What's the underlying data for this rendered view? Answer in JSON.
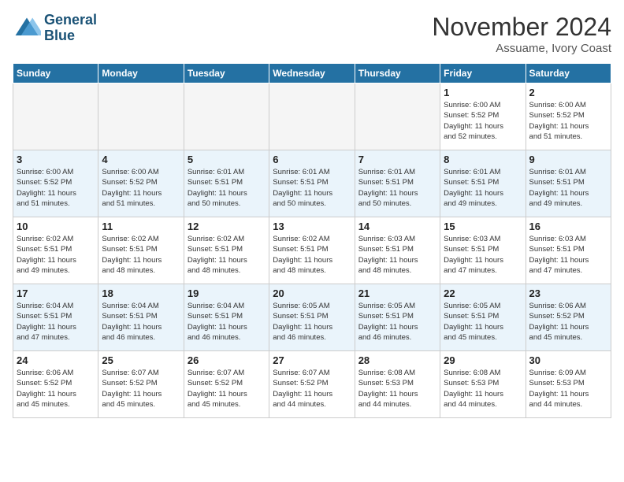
{
  "header": {
    "logo_line1": "General",
    "logo_line2": "Blue",
    "month": "November 2024",
    "location": "Assuame, Ivory Coast"
  },
  "weekdays": [
    "Sunday",
    "Monday",
    "Tuesday",
    "Wednesday",
    "Thursday",
    "Friday",
    "Saturday"
  ],
  "weeks": [
    [
      {
        "day": "",
        "info": ""
      },
      {
        "day": "",
        "info": ""
      },
      {
        "day": "",
        "info": ""
      },
      {
        "day": "",
        "info": ""
      },
      {
        "day": "",
        "info": ""
      },
      {
        "day": "1",
        "info": "Sunrise: 6:00 AM\nSunset: 5:52 PM\nDaylight: 11 hours\nand 52 minutes."
      },
      {
        "day": "2",
        "info": "Sunrise: 6:00 AM\nSunset: 5:52 PM\nDaylight: 11 hours\nand 51 minutes."
      }
    ],
    [
      {
        "day": "3",
        "info": "Sunrise: 6:00 AM\nSunset: 5:52 PM\nDaylight: 11 hours\nand 51 minutes."
      },
      {
        "day": "4",
        "info": "Sunrise: 6:00 AM\nSunset: 5:52 PM\nDaylight: 11 hours\nand 51 minutes."
      },
      {
        "day": "5",
        "info": "Sunrise: 6:01 AM\nSunset: 5:51 PM\nDaylight: 11 hours\nand 50 minutes."
      },
      {
        "day": "6",
        "info": "Sunrise: 6:01 AM\nSunset: 5:51 PM\nDaylight: 11 hours\nand 50 minutes."
      },
      {
        "day": "7",
        "info": "Sunrise: 6:01 AM\nSunset: 5:51 PM\nDaylight: 11 hours\nand 50 minutes."
      },
      {
        "day": "8",
        "info": "Sunrise: 6:01 AM\nSunset: 5:51 PM\nDaylight: 11 hours\nand 49 minutes."
      },
      {
        "day": "9",
        "info": "Sunrise: 6:01 AM\nSunset: 5:51 PM\nDaylight: 11 hours\nand 49 minutes."
      }
    ],
    [
      {
        "day": "10",
        "info": "Sunrise: 6:02 AM\nSunset: 5:51 PM\nDaylight: 11 hours\nand 49 minutes."
      },
      {
        "day": "11",
        "info": "Sunrise: 6:02 AM\nSunset: 5:51 PM\nDaylight: 11 hours\nand 48 minutes."
      },
      {
        "day": "12",
        "info": "Sunrise: 6:02 AM\nSunset: 5:51 PM\nDaylight: 11 hours\nand 48 minutes."
      },
      {
        "day": "13",
        "info": "Sunrise: 6:02 AM\nSunset: 5:51 PM\nDaylight: 11 hours\nand 48 minutes."
      },
      {
        "day": "14",
        "info": "Sunrise: 6:03 AM\nSunset: 5:51 PM\nDaylight: 11 hours\nand 48 minutes."
      },
      {
        "day": "15",
        "info": "Sunrise: 6:03 AM\nSunset: 5:51 PM\nDaylight: 11 hours\nand 47 minutes."
      },
      {
        "day": "16",
        "info": "Sunrise: 6:03 AM\nSunset: 5:51 PM\nDaylight: 11 hours\nand 47 minutes."
      }
    ],
    [
      {
        "day": "17",
        "info": "Sunrise: 6:04 AM\nSunset: 5:51 PM\nDaylight: 11 hours\nand 47 minutes."
      },
      {
        "day": "18",
        "info": "Sunrise: 6:04 AM\nSunset: 5:51 PM\nDaylight: 11 hours\nand 46 minutes."
      },
      {
        "day": "19",
        "info": "Sunrise: 6:04 AM\nSunset: 5:51 PM\nDaylight: 11 hours\nand 46 minutes."
      },
      {
        "day": "20",
        "info": "Sunrise: 6:05 AM\nSunset: 5:51 PM\nDaylight: 11 hours\nand 46 minutes."
      },
      {
        "day": "21",
        "info": "Sunrise: 6:05 AM\nSunset: 5:51 PM\nDaylight: 11 hours\nand 46 minutes."
      },
      {
        "day": "22",
        "info": "Sunrise: 6:05 AM\nSunset: 5:51 PM\nDaylight: 11 hours\nand 45 minutes."
      },
      {
        "day": "23",
        "info": "Sunrise: 6:06 AM\nSunset: 5:52 PM\nDaylight: 11 hours\nand 45 minutes."
      }
    ],
    [
      {
        "day": "24",
        "info": "Sunrise: 6:06 AM\nSunset: 5:52 PM\nDaylight: 11 hours\nand 45 minutes."
      },
      {
        "day": "25",
        "info": "Sunrise: 6:07 AM\nSunset: 5:52 PM\nDaylight: 11 hours\nand 45 minutes."
      },
      {
        "day": "26",
        "info": "Sunrise: 6:07 AM\nSunset: 5:52 PM\nDaylight: 11 hours\nand 45 minutes."
      },
      {
        "day": "27",
        "info": "Sunrise: 6:07 AM\nSunset: 5:52 PM\nDaylight: 11 hours\nand 44 minutes."
      },
      {
        "day": "28",
        "info": "Sunrise: 6:08 AM\nSunset: 5:53 PM\nDaylight: 11 hours\nand 44 minutes."
      },
      {
        "day": "29",
        "info": "Sunrise: 6:08 AM\nSunset: 5:53 PM\nDaylight: 11 hours\nand 44 minutes."
      },
      {
        "day": "30",
        "info": "Sunrise: 6:09 AM\nSunset: 5:53 PM\nDaylight: 11 hours\nand 44 minutes."
      }
    ]
  ]
}
